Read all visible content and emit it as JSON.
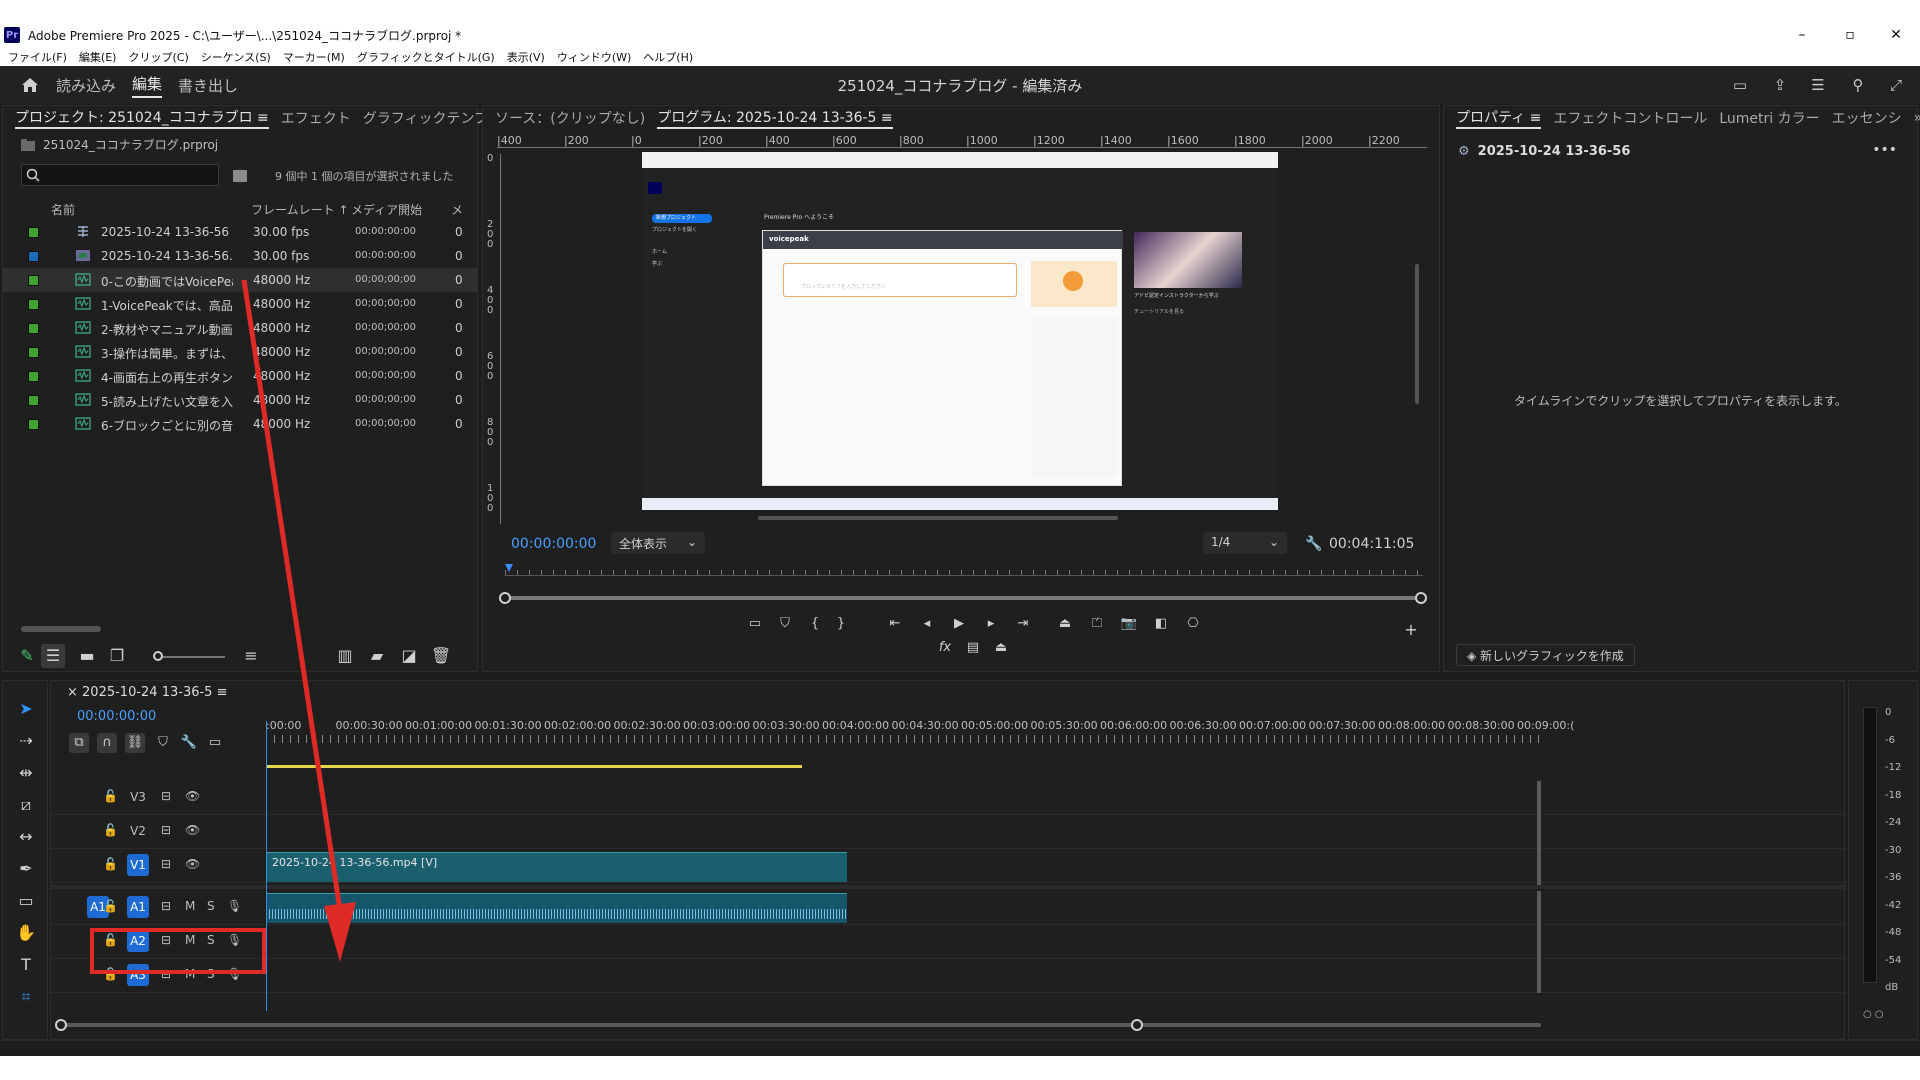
{
  "window": {
    "title": "Adobe Premiere Pro 2025 - C:\\ユーザー\\...\\251024_ココナラブログ.prproj *",
    "logo": "Pr"
  },
  "menu": [
    "ファイル(F)",
    "編集(E)",
    "クリップ(C)",
    "シーケンス(S)",
    "マーカー(M)",
    "グラフィックとタイトル(G)",
    "表示(V)",
    "ウィンドウ(W)",
    "ヘルプ(H)"
  ],
  "header": {
    "workspaces": [
      "読み込み",
      "編集",
      "書き出し"
    ],
    "active_workspace": "編集",
    "project_title": "251024_ココナラブログ - 編集済み"
  },
  "project_panel": {
    "tabs": [
      "プロジェクト: 251024_ココナラブロ ≡",
      "エフェクト",
      "グラフィックテンプ",
      "»"
    ],
    "file": "251024_ココナラブログ.prproj",
    "selection_info": "9 個中 1 個の項目が選択されました",
    "columns": [
      "名前",
      "フレームレート ↑",
      "メディア開始",
      "メ"
    ],
    "items": [
      {
        "name": "2025-10-24 13-36-56",
        "rate": "30.00 fps",
        "start": "00:00:00:00",
        "last": "0",
        "color": "#3fa32f",
        "kind": "sequence"
      },
      {
        "name": "2025-10-24 13-36-56.mp",
        "rate": "30.00 fps",
        "start": "00:00:00:00",
        "last": "0",
        "color": "#1b6bb8",
        "kind": "video"
      },
      {
        "name": "0-この動画ではVoicePeak",
        "rate": "48000 Hz",
        "start": "00;00;00;00",
        "last": "0",
        "color": "#3fa32f",
        "kind": "audio"
      },
      {
        "name": "1-VoicePeakでは、高品質",
        "rate": "48000 Hz",
        "start": "00;00;00;00",
        "last": "0",
        "color": "#3fa32f",
        "kind": "audio"
      },
      {
        "name": "2-教材やマニュアル動画の",
        "rate": "48000 Hz",
        "start": "00;00;00;00",
        "last": "0",
        "color": "#3fa32f",
        "kind": "audio"
      },
      {
        "name": "3-操作は簡単。まずは、読",
        "rate": "48000 Hz",
        "start": "00;00;00;00",
        "last": "0",
        "color": "#3fa32f",
        "kind": "audio"
      },
      {
        "name": "4-画面右上の再生ボタンを",
        "rate": "48000 Hz",
        "start": "00;00;00;00",
        "last": "0",
        "color": "#3fa32f",
        "kind": "audio"
      },
      {
        "name": "5-読み上げたい文章を入力",
        "rate": "48000 Hz",
        "start": "00;00;00;00",
        "last": "0",
        "color": "#3fa32f",
        "kind": "audio"
      },
      {
        "name": "6-ブロックごとに別の音声",
        "rate": "48000 Hz",
        "start": "00;00;00;00",
        "last": "0",
        "color": "#3fa32f",
        "kind": "audio"
      }
    ]
  },
  "program_panel": {
    "tabs": [
      "ソース：(クリップなし)",
      "プログラム: 2025-10-24 13-36-5 ≡"
    ],
    "ruler": [
      "400",
      "200",
      "0",
      "200",
      "400",
      "600",
      "800",
      "1000",
      "1200",
      "1400",
      "1600",
      "1800",
      "2000",
      "2200"
    ],
    "ruler_left": [
      "0",
      "2 0 0",
      "4 0 0",
      "6 0 0",
      "8 0 0",
      "1 0 0"
    ],
    "timecode": "00:00:00:00",
    "zoom": "全体表示",
    "resolution": "1/4",
    "duration": "00:04:11:05",
    "video_content": {
      "app_name": "Premiere Pro へようこそ",
      "voice_app": "voicepeak",
      "new_project": "新規プロジェクト",
      "open_project": "プロジェクトを開く",
      "home": "ホーム",
      "learn": "学ぶ",
      "tutorial_text": "アドビ認定インストラクターから学ぶ",
      "tutorial_sub": "チュートリアルを見る",
      "placeholder": "ブロックにセリフを入力してください"
    }
  },
  "properties_panel": {
    "tabs": [
      "プロパティ ≡",
      "エフェクトコントロール",
      "Lumetri カラー",
      "エッセンシ",
      "»"
    ],
    "clip_name": "2025-10-24 13-36-56",
    "message": "タイムラインでクリップを選択してプロパティを表示します。",
    "new_graphic": "新しいグラフィックを作成"
  },
  "timeline": {
    "sequence": "2025-10-24 13-36-5",
    "timecode": "00:00:00:00",
    "ruler": [
      ":00:00",
      "00:00:30:00",
      "00:01:00:00",
      "00:01:30:00",
      "00:02:00:00",
      "00:02:30:00",
      "00:03:00:00",
      "00:03:30:00",
      "00:04:00:00",
      "00:04:30:00",
      "00:05:00:00",
      "00:05:30:00",
      "00:06:00:00",
      "00:06:30:00",
      "00:07:00:00",
      "00:07:30:00",
      "00:08:00:00",
      "00:08:30:00",
      "00:09:00:("
    ],
    "video_tracks": [
      "V3",
      "V2",
      "V1"
    ],
    "audio_tracks": [
      "A1",
      "A2",
      "A3"
    ],
    "source_patch": "A1",
    "video_clip": "2025-10-24 13-36-56.mp4 [V]",
    "ms_labels": [
      "M",
      "S"
    ]
  },
  "audio_meter": {
    "labels": [
      "0",
      "-6",
      "-12",
      "-18",
      "-24",
      "-30",
      "-36",
      "-42",
      "-48",
      "-54",
      "dB"
    ],
    "footer": "○ ○"
  },
  "annotation": {
    "color": "#e02a25"
  }
}
